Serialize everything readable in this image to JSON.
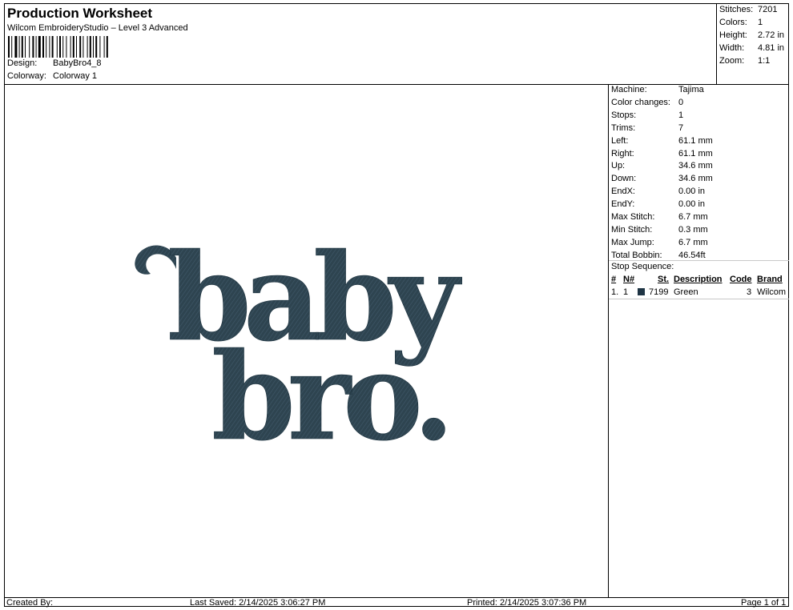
{
  "header": {
    "title": "Production Worksheet",
    "software": "Wilcom EmbroideryStudio – Level 3 Advanced",
    "design_label": "Design:",
    "design_value": "BabyBro4_8",
    "colorway_label": "Colorway:",
    "colorway_value": "Colorway 1"
  },
  "stats": {
    "stitches": {
      "label": "Stitches:",
      "value": "7201"
    },
    "colors": {
      "label": "Colors:",
      "value": "1"
    },
    "height": {
      "label": "Height:",
      "value": "2.72 in"
    },
    "width": {
      "label": "Width:",
      "value": "4.81 in"
    },
    "zoom": {
      "label": "Zoom:",
      "value": "1:1"
    }
  },
  "machine_info": [
    {
      "label": "Machine:",
      "value": "Tajima"
    },
    {
      "label": "Color changes:",
      "value": "0"
    },
    {
      "label": "Stops:",
      "value": "1"
    },
    {
      "label": "Trims:",
      "value": "7"
    },
    {
      "label": "Left:",
      "value": "61.1 mm"
    },
    {
      "label": "Right:",
      "value": "61.1 mm"
    },
    {
      "label": "Up:",
      "value": "34.6 mm"
    },
    {
      "label": "Down:",
      "value": "34.6 mm"
    },
    {
      "label": "EndX:",
      "value": "0.00 in"
    },
    {
      "label": "EndY:",
      "value": "0.00 in"
    },
    {
      "label": "Max Stitch:",
      "value": "6.7 mm"
    },
    {
      "label": "Min Stitch:",
      "value": "0.3 mm"
    },
    {
      "label": "Max Jump:",
      "value": "6.7 mm"
    },
    {
      "label": "Total Bobbin:",
      "value": "46.54ft"
    }
  ],
  "stop_sequence": {
    "label": "Stop Sequence:",
    "headers": {
      "num": "#",
      "n": "N#",
      "st": "St.",
      "desc": "Description",
      "code": "Code",
      "brand": "Brand"
    },
    "rows": [
      {
        "num": "1.",
        "n": "1",
        "st": "7199",
        "desc": "Green",
        "code": "3",
        "brand": "Wilcom",
        "color": "#1e3444"
      }
    ]
  },
  "design": {
    "line1": "baby",
    "line2": "bro.",
    "thread_color": "#2e4450"
  },
  "footer": {
    "created_by": "Created By:",
    "last_saved": "Last Saved: 2/14/2025 3:06:27 PM",
    "printed": "Printed: 2/14/2025 3:07:36 PM",
    "page": "Page 1 of 1"
  }
}
